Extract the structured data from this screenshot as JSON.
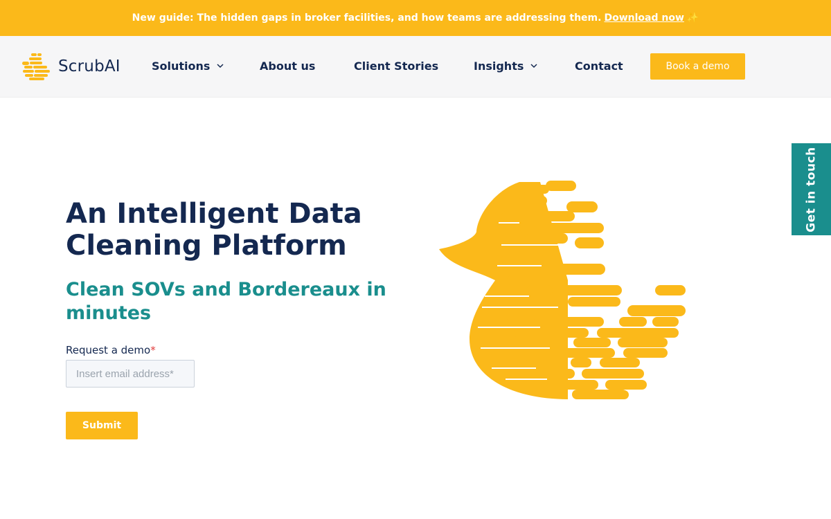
{
  "announcement": {
    "text": "New guide: The hidden gaps in broker facilities, and how teams are addressing them.",
    "link_label": "Download now",
    "sparkle": "✨"
  },
  "brand": {
    "name": "ScrubAI",
    "primary_color": "#FBB91A",
    "navy_color": "#142850",
    "teal_color": "#1A8E8D"
  },
  "nav": {
    "items": [
      {
        "label": "Solutions",
        "icon": "chevron-down-icon"
      },
      {
        "label": "About us"
      },
      {
        "label": "Client Stories"
      },
      {
        "label": "Insights",
        "icon": "chevron-down-icon"
      },
      {
        "label": "Contact"
      }
    ],
    "cta_label": "Book a demo"
  },
  "side_tab": {
    "label": "Get in touch"
  },
  "hero": {
    "title_line1": "An Intelligent Data",
    "title_line2": "Cleaning Platform",
    "subtitle_line1": "Clean SOVs and Bordereaux in",
    "subtitle_line2": "minutes",
    "form": {
      "label": "Request a demo",
      "required_mark": "*",
      "email_placeholder": "Insert email address*",
      "email_value": "",
      "submit_label": "Submit"
    }
  }
}
